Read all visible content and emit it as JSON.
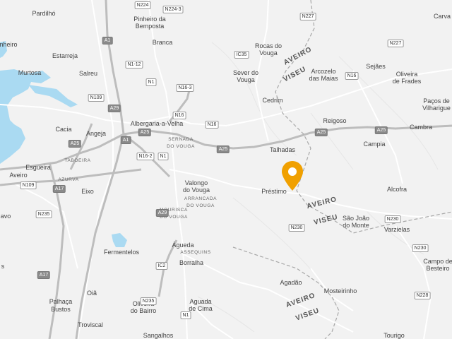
{
  "map": {
    "pin_color": "#f0a000",
    "places": [
      {
        "id": "pardilho",
        "label": "Pardilhó"
      },
      {
        "id": "pinheiro",
        "label": "Pinheiro da\nBemposta"
      },
      {
        "id": "carva",
        "label": "Carva"
      },
      {
        "id": "inheiro",
        "label": "nheiro"
      },
      {
        "id": "estarreja",
        "label": "Estarreja"
      },
      {
        "id": "branca",
        "label": "Branca"
      },
      {
        "id": "rocas",
        "label": "Rocas do\nVouga"
      },
      {
        "id": "murtosa",
        "label": "Murtosa"
      },
      {
        "id": "salreu",
        "label": "Salreu"
      },
      {
        "id": "sever",
        "label": "Sever do\nVouga"
      },
      {
        "id": "arcozelo",
        "label": "Arcozelo\ndas Maias"
      },
      {
        "id": "sejaes",
        "label": "Sejães"
      },
      {
        "id": "oliveira_frades",
        "label": "Oliveira\nde Frades"
      },
      {
        "id": "pacos",
        "label": "Paços de\nVilharigue"
      },
      {
        "id": "cedrim",
        "label": "Cedrim"
      },
      {
        "id": "cacia",
        "label": "Cacia"
      },
      {
        "id": "angeja",
        "label": "Angeja"
      },
      {
        "id": "albergaria",
        "label": "Albergaria-a-Velha"
      },
      {
        "id": "reigoso",
        "label": "Reigoso"
      },
      {
        "id": "cambra",
        "label": "Cambra"
      },
      {
        "id": "talhadas",
        "label": "Talhadas"
      },
      {
        "id": "campia",
        "label": "Campia"
      },
      {
        "id": "esgueira",
        "label": "Esgueira"
      },
      {
        "id": "aveiro",
        "label": "Aveiro"
      },
      {
        "id": "valongo",
        "label": "Valongo\ndo Vouga"
      },
      {
        "id": "prestimo",
        "label": "Préstimo"
      },
      {
        "id": "alcofra",
        "label": "Alcofra"
      },
      {
        "id": "eixo",
        "label": "Eixo"
      },
      {
        "id": "ilhavo",
        "label": "avo"
      },
      {
        "id": "sao_joao",
        "label": "São João\ndo Monte"
      },
      {
        "id": "varzielas",
        "label": "Varzielas"
      },
      {
        "id": "fermentelos",
        "label": "Fermentelos"
      },
      {
        "id": "agueda",
        "label": "Águeda"
      },
      {
        "id": "borralha",
        "label": "Borralha"
      },
      {
        "id": "campo_besteiros",
        "label": "Campo de\nBesteiro"
      },
      {
        "id": "s_left",
        "label": "s"
      },
      {
        "id": "agadao",
        "label": "Agadão"
      },
      {
        "id": "oia",
        "label": "Oiã"
      },
      {
        "id": "mosteirinho",
        "label": "Mosteirinho"
      },
      {
        "id": "palhaca",
        "label": "Palhaça"
      },
      {
        "id": "oliveira_bairro",
        "label": "Oliveira\ndo Bairro"
      },
      {
        "id": "aguada",
        "label": "Aguada\nde Cima"
      },
      {
        "id": "bustos",
        "label": "Bustos"
      },
      {
        "id": "troviscal",
        "label": "Troviscal"
      },
      {
        "id": "sangalhos",
        "label": "Sangalhos"
      },
      {
        "id": "tourigo",
        "label": "Tourigo"
      }
    ],
    "small_labels": [
      {
        "id": "taboeira",
        "label": "TABOEIRA"
      },
      {
        "id": "sernada",
        "label": "SERNADA\nDO VOUGA"
      },
      {
        "id": "azurva",
        "label": "AZURVA"
      },
      {
        "id": "arrancada",
        "label": "ARRANCADA\nDO VOUGA"
      },
      {
        "id": "mourisca",
        "label": "MOURISCA\nDO VOUGA"
      },
      {
        "id": "assequins",
        "label": "ASSEQUINS"
      }
    ],
    "road_shields": [
      {
        "id": "n224",
        "label": "N224"
      },
      {
        "id": "n224_3",
        "label": "N224-3"
      },
      {
        "id": "n227_top",
        "label": "N227"
      },
      {
        "id": "a1_top",
        "label": "A1"
      },
      {
        "id": "ic35",
        "label": "IC35"
      },
      {
        "id": "n227_right",
        "label": "N227"
      },
      {
        "id": "n1_12",
        "label": "N1-12"
      },
      {
        "id": "n1_a",
        "label": "N1"
      },
      {
        "id": "n16_3",
        "label": "N16-3"
      },
      {
        "id": "n16_right",
        "label": "N16"
      },
      {
        "id": "n109_top",
        "label": "N109"
      },
      {
        "id": "a29_top",
        "label": "A29"
      },
      {
        "id": "n16_mid",
        "label": "N16"
      },
      {
        "id": "n16_b",
        "label": "N16"
      },
      {
        "id": "a25_a",
        "label": "A25"
      },
      {
        "id": "a25_b",
        "label": "A25"
      },
      {
        "id": "a25_c",
        "label": "A25"
      },
      {
        "id": "a1_mid",
        "label": "A1"
      },
      {
        "id": "a25_left",
        "label": "A25"
      },
      {
        "id": "n16_2",
        "label": "N16-2"
      },
      {
        "id": "n1_b",
        "label": "N1"
      },
      {
        "id": "a25_d",
        "label": "A25"
      },
      {
        "id": "n109_left",
        "label": "N109"
      },
      {
        "id": "a17_a",
        "label": "A17"
      },
      {
        "id": "n235_a",
        "label": "N235"
      },
      {
        "id": "a29_b",
        "label": "A29"
      },
      {
        "id": "n230_a",
        "label": "N230"
      },
      {
        "id": "n230_b",
        "label": "N230"
      },
      {
        "id": "n230_c",
        "label": "N230"
      },
      {
        "id": "a17_b",
        "label": "A17"
      },
      {
        "id": "ic2",
        "label": "IC2"
      },
      {
        "id": "n228",
        "label": "N228"
      },
      {
        "id": "n235_b",
        "label": "N235"
      },
      {
        "id": "n1_c",
        "label": "N1"
      }
    ],
    "district_labels": [
      {
        "id": "aveiro_top",
        "label": "AVEIRO"
      },
      {
        "id": "viseu_top",
        "label": "VISEU"
      },
      {
        "id": "aveiro_mid",
        "label": "AVEIRO"
      },
      {
        "id": "viseu_mid",
        "label": "VISEU"
      },
      {
        "id": "aveiro_bot",
        "label": "AVEIRO"
      },
      {
        "id": "viseu_bot",
        "label": "VISEU"
      }
    ]
  }
}
